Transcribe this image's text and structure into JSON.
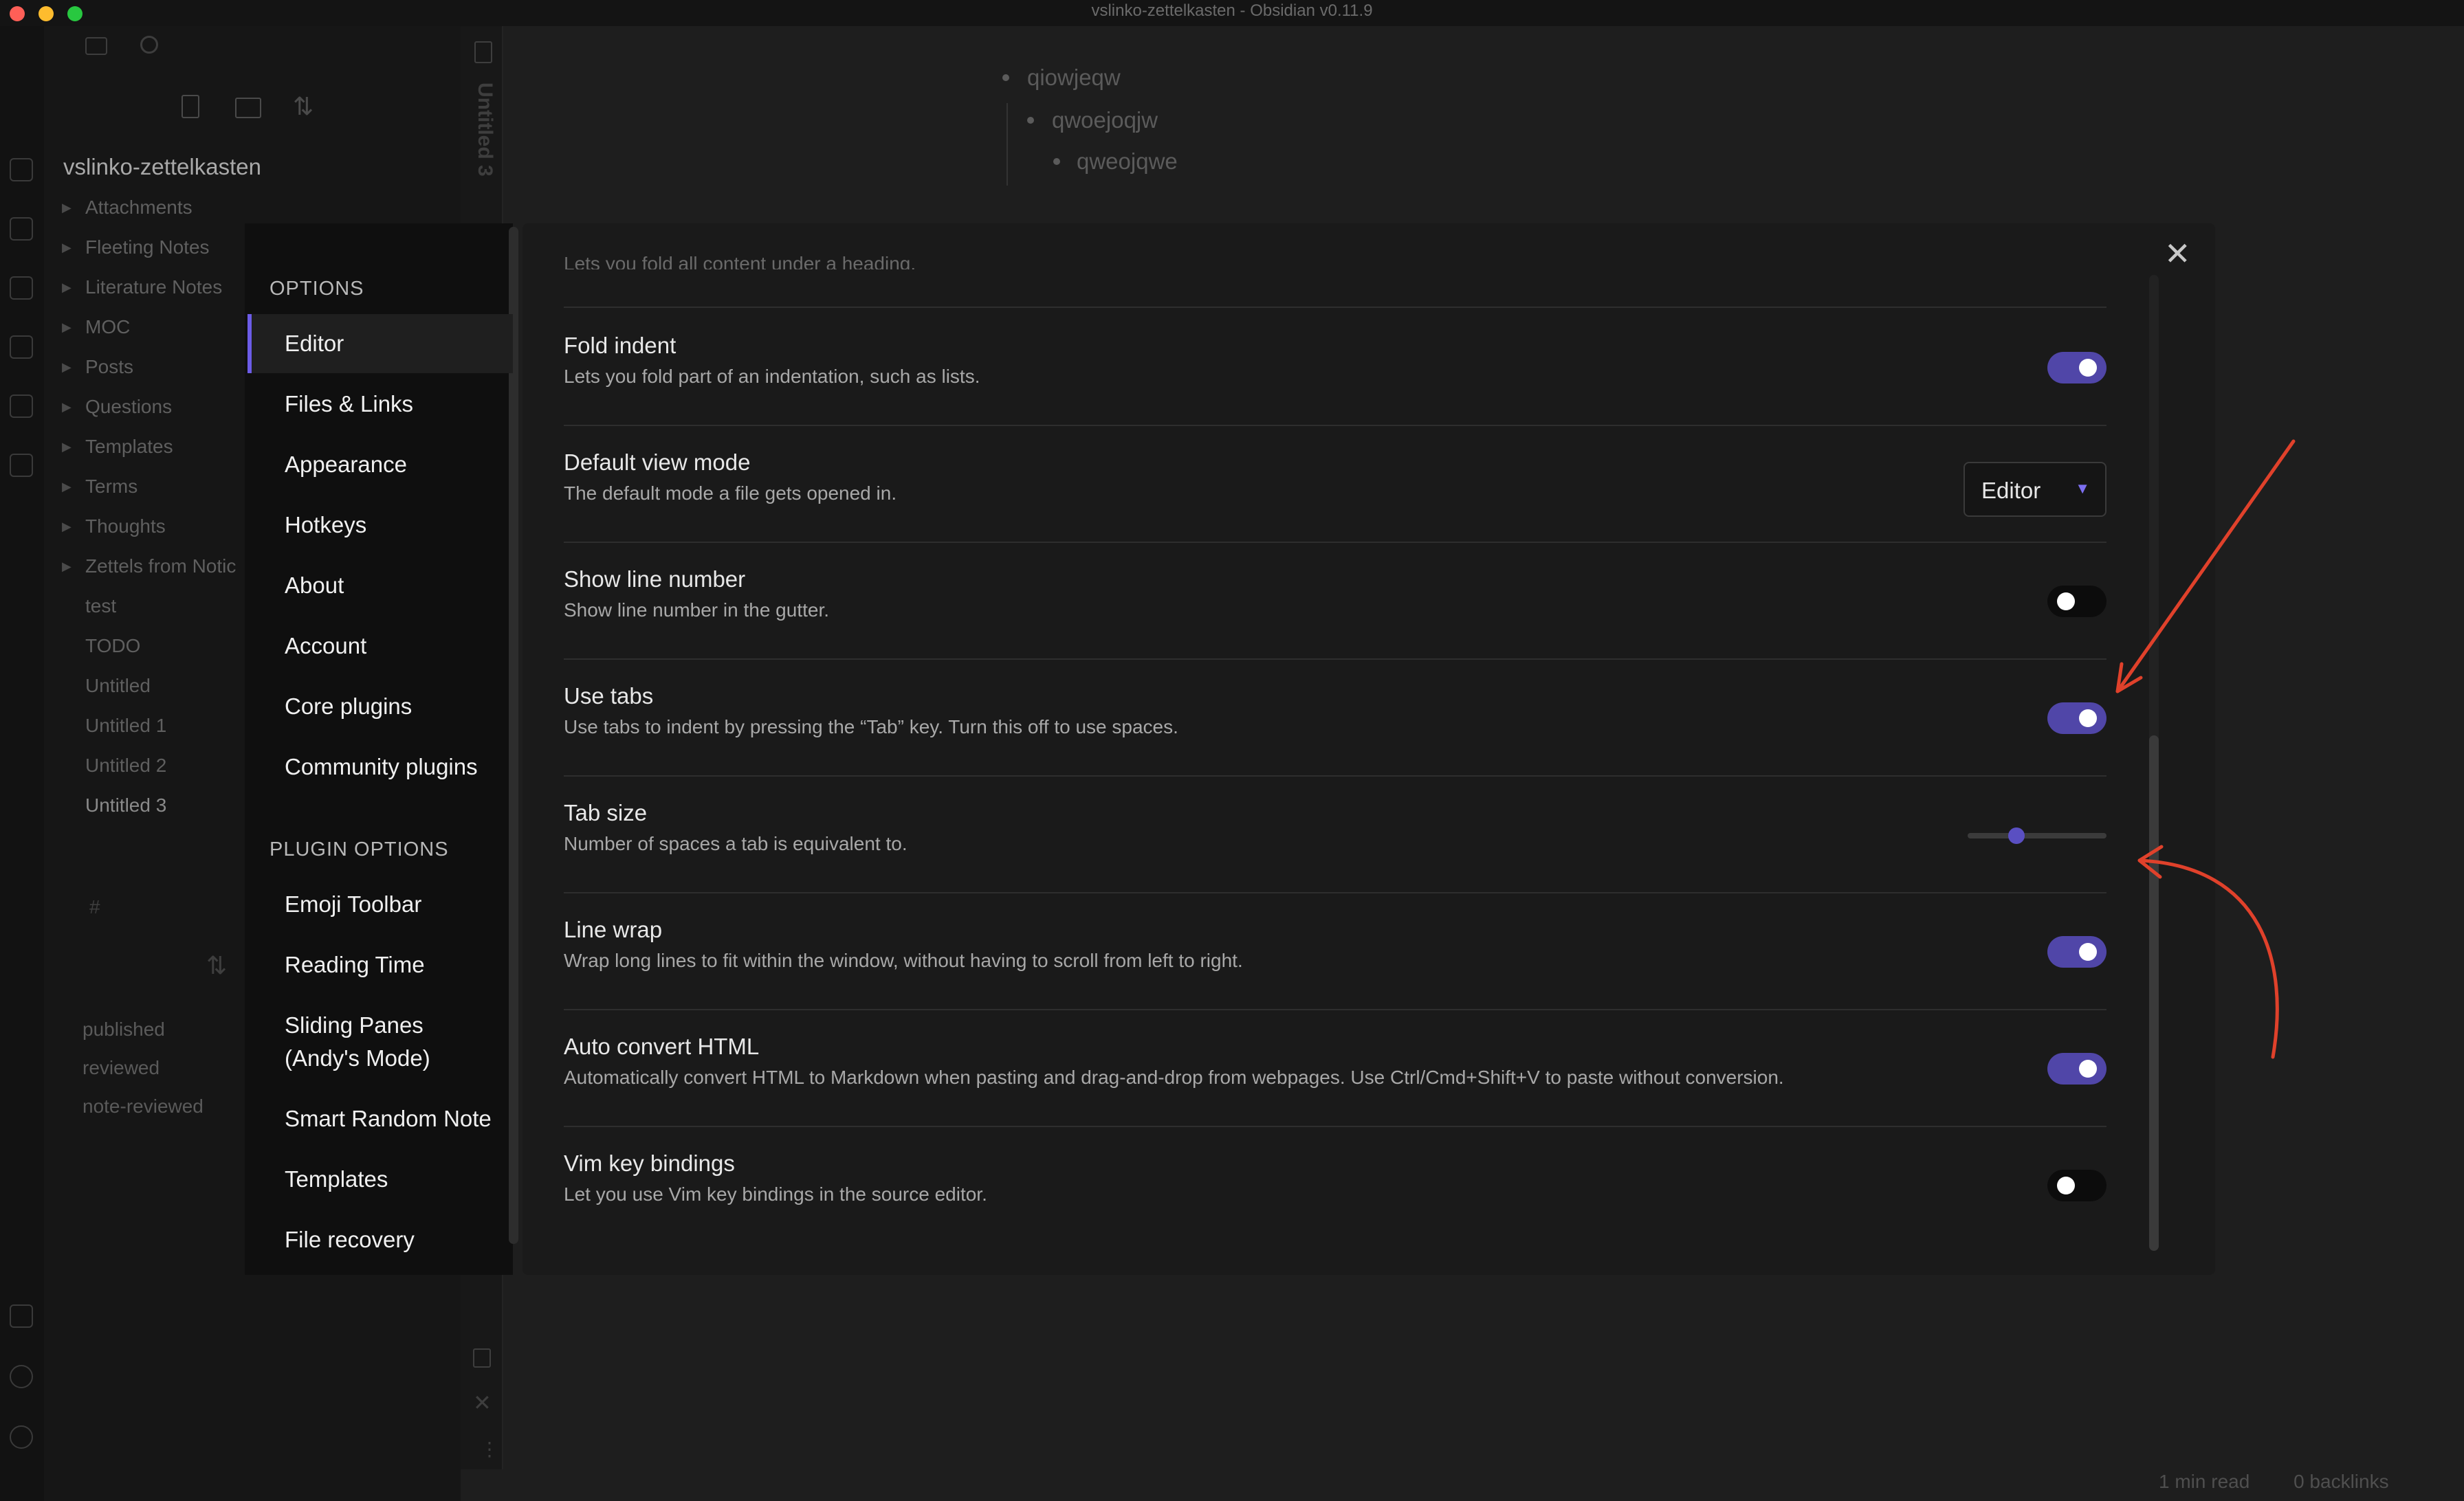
{
  "window": {
    "title": "vslinko-zettelkasten - Obsidian v0.11.9"
  },
  "explorer": {
    "vault_name": "vslinko-zettelkasten",
    "folders": [
      "Attachments",
      "Fleeting Notes",
      "Literature Notes",
      "MOC",
      "Posts",
      "Questions",
      "Templates",
      "Terms",
      "Thoughts",
      "Zettels from Notic"
    ],
    "files": [
      "test",
      "TODO",
      "Untitled",
      "Untitled 1",
      "Untitled 2",
      "Untitled 3"
    ],
    "tags": [
      "published",
      "reviewed",
      "note-reviewed"
    ],
    "tag_icon": "#"
  },
  "editor": {
    "tab_title": "Untitled 3",
    "bullets": [
      "qiowjeqw",
      "qwoejoqjw",
      "qweojqwe"
    ],
    "status": {
      "read_time": "1 min read",
      "backlinks": "0 backlinks"
    }
  },
  "settings_modal": {
    "sidebar": {
      "options_heading": "OPTIONS",
      "options": [
        "Editor",
        "Files & Links",
        "Appearance",
        "Hotkeys",
        "About",
        "Account",
        "Core plugins",
        "Community plugins"
      ],
      "plugin_heading": "PLUGIN OPTIONS",
      "plugins": [
        "Emoji Toolbar",
        "Reading Time",
        "Sliding Panes",
        "(Andy's Mode)",
        "Smart Random Note",
        "Templates",
        "File recovery"
      ]
    },
    "cut_text": "Lets you fold all content under a heading.",
    "settings": [
      {
        "name": "Fold indent",
        "desc": "Lets you fold part of an indentation, such as lists.",
        "control": "toggle",
        "on": true
      },
      {
        "name": "Default view mode",
        "desc": "The default mode a file gets opened in.",
        "control": "dropdown",
        "value": "Editor"
      },
      {
        "name": "Show line number",
        "desc": "Show line number in the gutter.",
        "control": "toggle",
        "on": false
      },
      {
        "name": "Use tabs",
        "desc": "Use tabs to indent by pressing the “Tab” key. Turn this off to use spaces.",
        "control": "toggle",
        "on": true
      },
      {
        "name": "Tab size",
        "desc": "Number of spaces a tab is equivalent to.",
        "control": "slider",
        "value_fraction": 0.35
      },
      {
        "name": "Line wrap",
        "desc": "Wrap long lines to fit within the window, without having to scroll from left to right.",
        "control": "toggle",
        "on": true
      },
      {
        "name": "Auto convert HTML",
        "desc": "Automatically convert HTML to Markdown when pasting and drag-and-drop from webpages. Use Ctrl/Cmd+Shift+V to paste without conversion.",
        "control": "toggle",
        "on": true
      },
      {
        "name": "Vim key bindings",
        "desc": "Let you use Vim key bindings in the source editor.",
        "control": "toggle",
        "on": false
      }
    ]
  },
  "colors": {
    "accent": "#5046a8",
    "annotation": "#e0412b"
  }
}
